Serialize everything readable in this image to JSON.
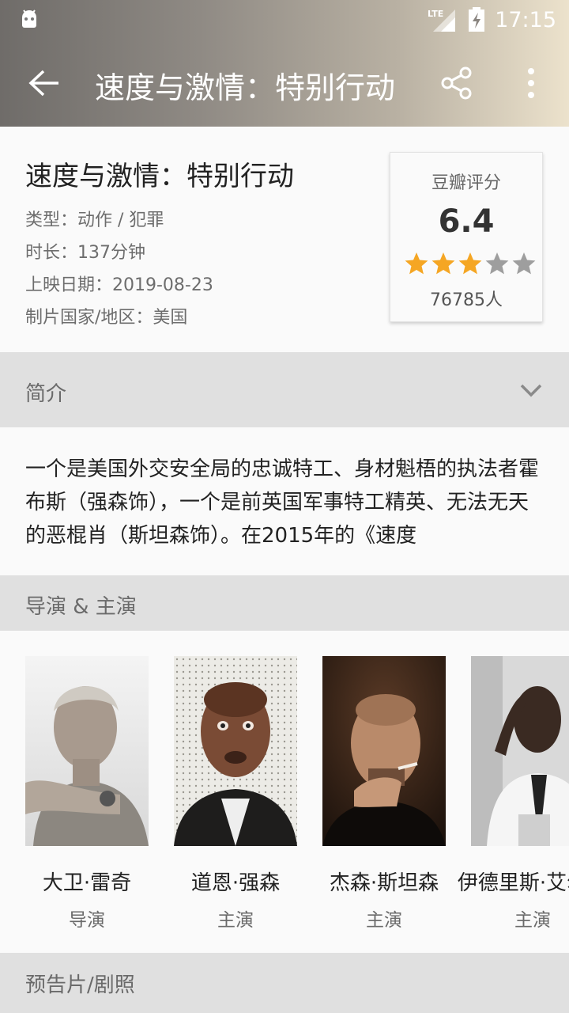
{
  "status_bar": {
    "time": "17:15",
    "network": "LTE"
  },
  "toolbar": {
    "title": "速度与激情：特别行动"
  },
  "movie": {
    "title": "速度与激情：特别行动",
    "type": "类型：动作 / 犯罪",
    "duration": "时长：137分钟",
    "release": "上映日期：2019-08-23",
    "country": "制片国家/地区：美国"
  },
  "rating": {
    "label": "豆瓣评分",
    "score": "6.4",
    "stars_filled": 3,
    "stars_total": 5,
    "count": "76785人",
    "star_color": "#f5a623",
    "star_empty_color": "#9e9e9e"
  },
  "sections": {
    "synopsis": "简介",
    "cast": "导演 & 主演",
    "trailer": "预告片/剧照"
  },
  "synopsis_text": "一个是美国外交安全局的忠诚特工、身材魁梧的执法者霍布斯（强森饰），一个是前英国军事特工精英、无法无天的恶棍肖（斯坦森饰）。在2015年的《速度",
  "cast": [
    {
      "name": "大卫·雷奇",
      "role": "导演"
    },
    {
      "name": "道恩·强森",
      "role": "主演"
    },
    {
      "name": "杰森·斯坦森",
      "role": "主演"
    },
    {
      "name": "伊德里斯·艾尔巴",
      "role": "主演"
    }
  ],
  "colors": {
    "accent_header_start": "#6f6c69",
    "accent_header_end": "#ece2cc",
    "section_bg": "#e0e0e0"
  }
}
